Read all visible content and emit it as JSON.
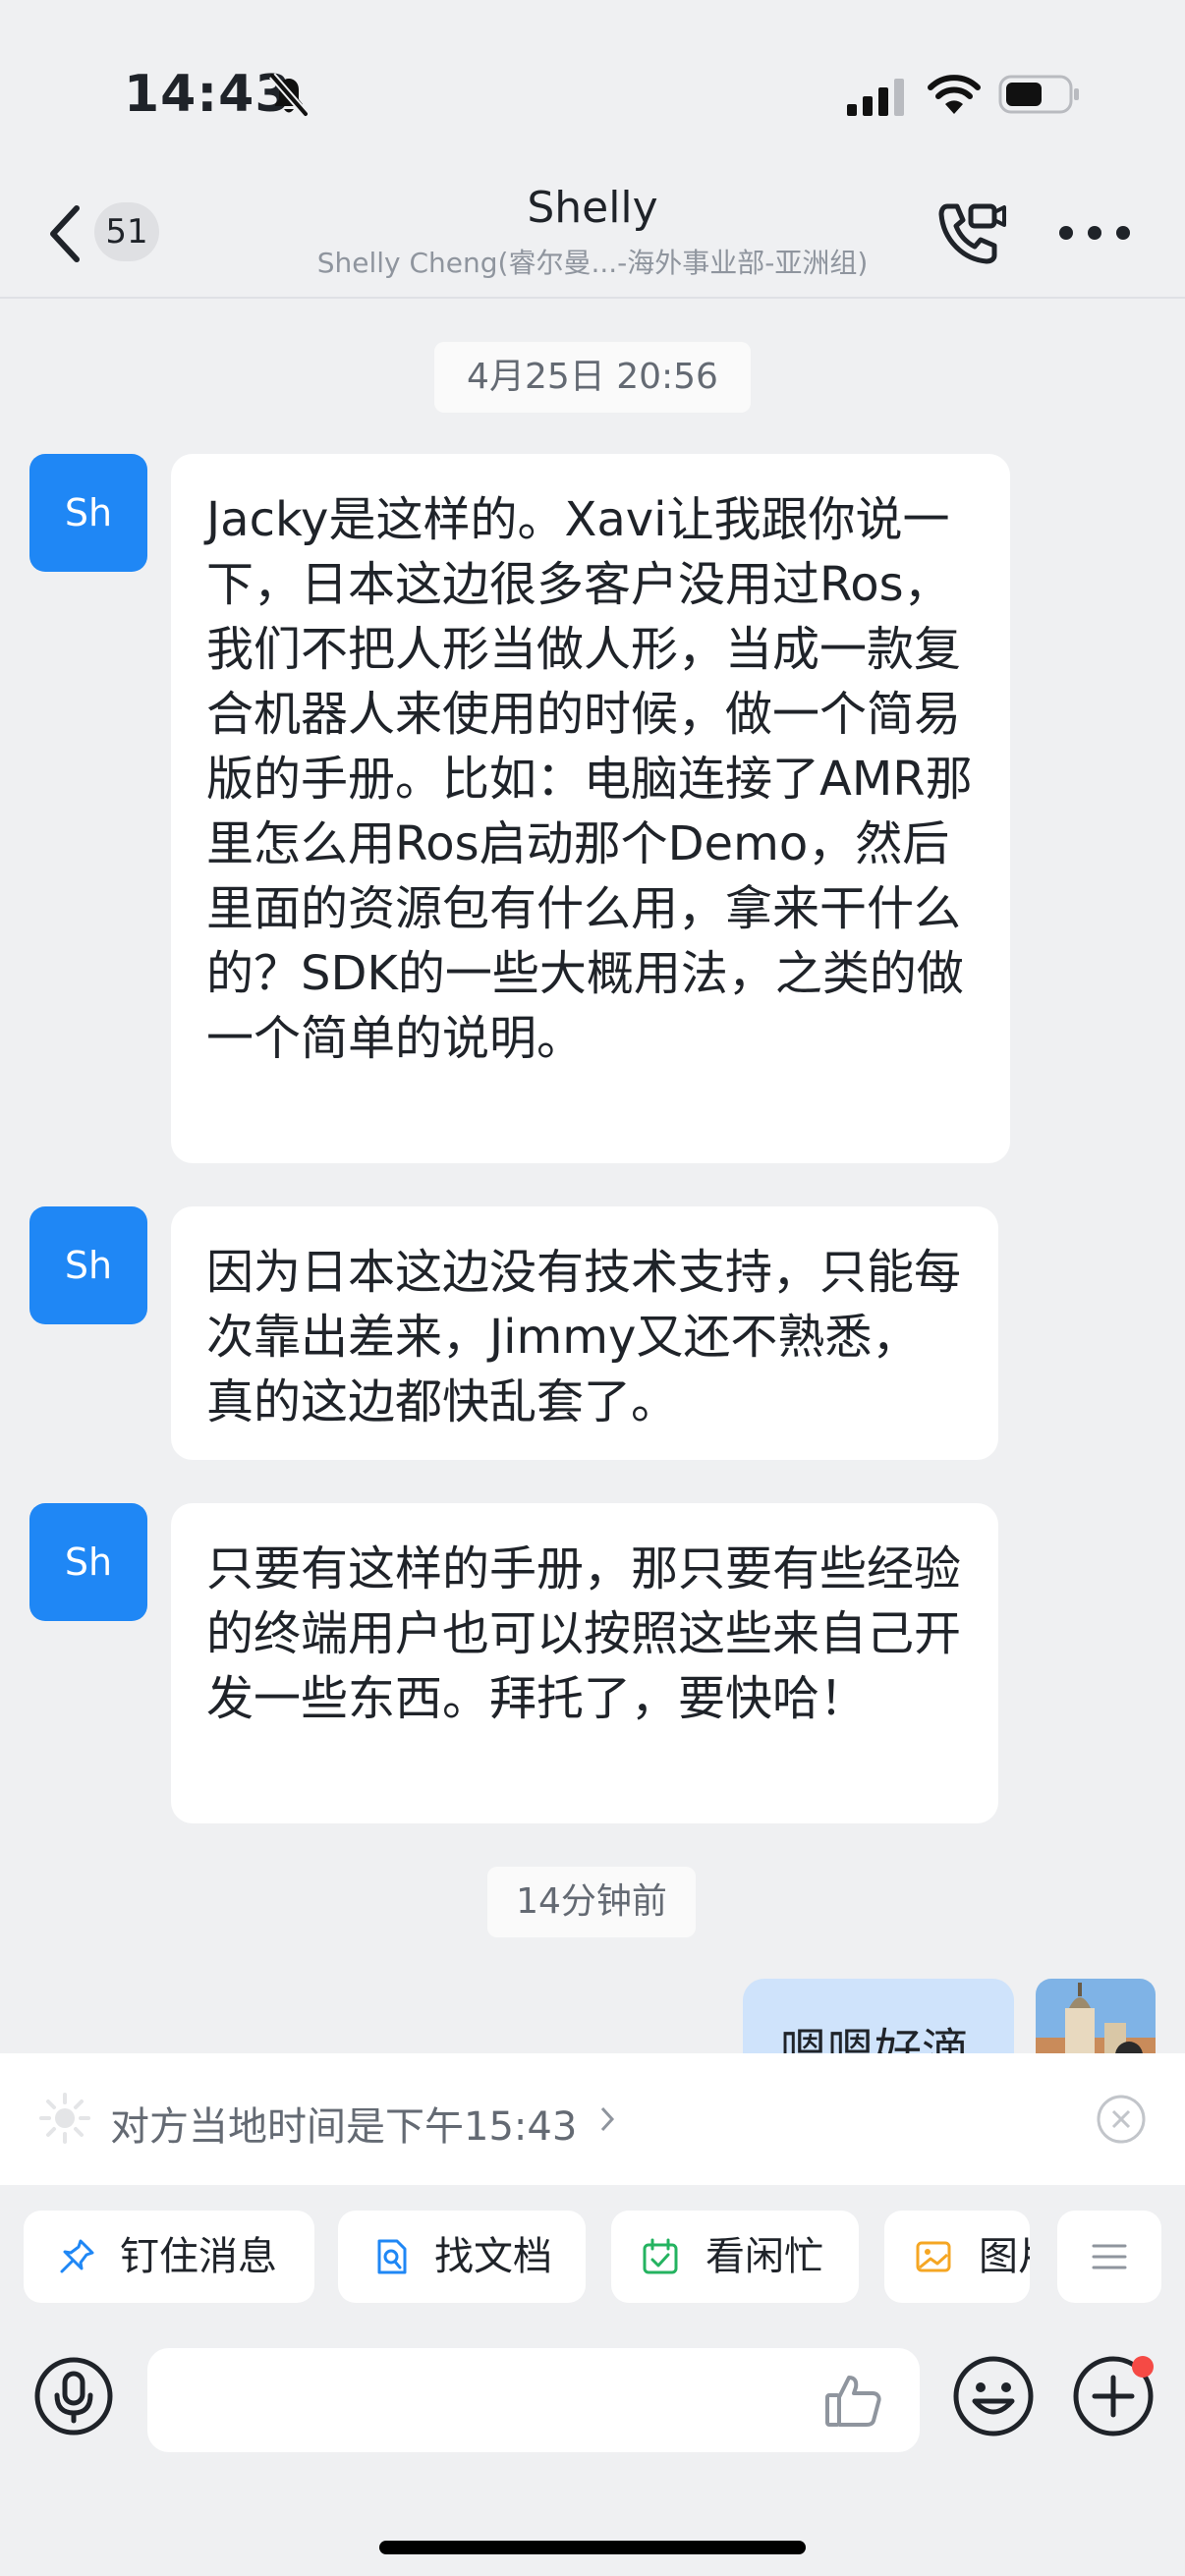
{
  "status_bar": {
    "time": "14:43"
  },
  "header": {
    "unread_count": "51",
    "title": "Shelly",
    "subtitle": "Shelly Cheng(睿尔曼...-海外事业部-亚洲组)"
  },
  "messages": {
    "timestamp_1": "4月25日 20:56",
    "timestamp_2": "14分钟前",
    "items": [
      {
        "sender_initials": "Sh",
        "text": "Jacky是这样的。Xavi让我跟你说一下，日本这边很多客户没用过Ros，我们不把人形当做人形，当成一款复合机器人来使用的时候，做一个简易版的手册。比如：电脑连接了AMR那里怎么用Ros启动那个Demo，然后里面的资源包有什么用，拿来干什么的？SDK的一些大概用法，之类的做一个简单的说明。"
      },
      {
        "sender_initials": "Sh",
        "text": "因为日本这边没有技术支持，只能每次靠出差来，Jimmy又还不熟悉，真的这边都快乱套了。"
      },
      {
        "sender_initials": "Sh",
        "text": "只要有这样的手册，那只要有些经验的终端用户也可以按照这些来自己开发一些东西。拜托了，要快哈！"
      }
    ],
    "outgoing_preview": "嗯嗯好滴"
  },
  "local_time_tip": {
    "text": "对方当地时间是下午15:43"
  },
  "quick_actions": {
    "pin": "钉住消息",
    "docs": "找文档",
    "busy": "看闲忙",
    "image": "图片"
  },
  "input": {
    "placeholder": "",
    "value": ""
  },
  "colors": {
    "accent": "#1f87f5",
    "background": "#eff0f2",
    "outgoing_bubble": "#cfe3fb",
    "notification_dot": "#f54a45"
  }
}
